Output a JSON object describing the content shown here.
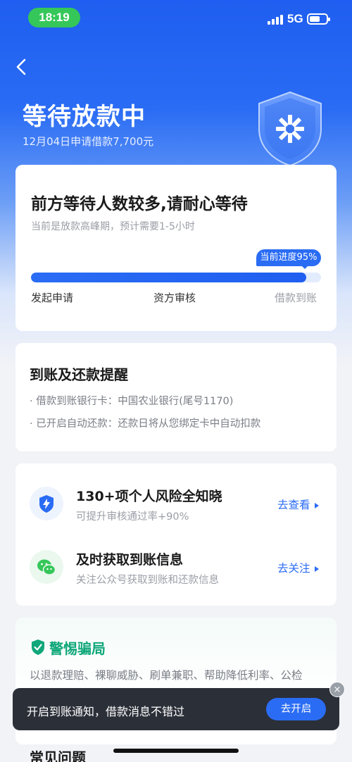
{
  "status_bar": {
    "time": "18:19",
    "network": "5G"
  },
  "header": {
    "title": "等待放款中",
    "subtitle": "12月04日申请借款7,700元"
  },
  "progress_card": {
    "title": "前方等待人数较多,请耐心等待",
    "desc": "当前是放款高峰期，预计需要1-5小时",
    "badge": "当前进度95%",
    "progress_percent": 95,
    "steps": [
      "发起申请",
      "资方审核",
      "借款到账"
    ]
  },
  "reminder_card": {
    "title": "到账及还款提醒",
    "items": [
      "· 借款到账银行卡：中国农业银行(尾号1170)",
      "· 已开启自动还款：还款日将从您绑定卡中自动扣款"
    ]
  },
  "service_card": {
    "rows": [
      {
        "title": "130+项个人风险全知晓",
        "subtitle": "可提升审核通过率+90%",
        "link": "去查看",
        "icon": "shield-bolt-icon"
      },
      {
        "title": "及时获取到账信息",
        "subtitle": "关注公众号获取到账和还款信息",
        "link": "去关注",
        "icon": "wechat-icon"
      }
    ]
  },
  "warning_card": {
    "title": "警惕骗局",
    "text": "以退款理赔、裸聊威胁、刷单兼职、帮助降低利率、公检"
  },
  "toast": {
    "text": "开启到账通知，借款消息不错过",
    "button": "去开启",
    "close": "×"
  },
  "faq": {
    "title": "常见问题"
  },
  "colors": {
    "brand": "#2a6cf4",
    "success": "#10a77a",
    "wechat": "#35c759"
  }
}
